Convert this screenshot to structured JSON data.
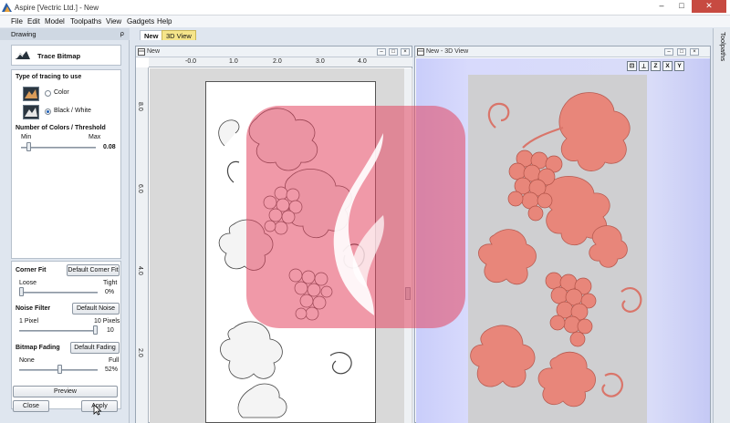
{
  "app": {
    "title": "Aspire [Vectric Ltd.] - New"
  },
  "window_controls": {
    "minimize": "‒",
    "maximize": "□",
    "close": "✕"
  },
  "menu": [
    "File",
    "Edit",
    "Model",
    "Toolpaths",
    "View",
    "Gadgets",
    "Help"
  ],
  "drawing_panel": {
    "header": "Drawing",
    "pin": "⍴",
    "tool_title": "Trace Bitmap",
    "type_section": "Type of tracing to use",
    "options": [
      {
        "label": "Color",
        "selected": false
      },
      {
        "label": "Black / White",
        "selected": true
      }
    ],
    "threshold": {
      "title": "Number of Colors / Threshold",
      "min_label": "Min",
      "max_label": "Max",
      "value": "0.08",
      "level": 0.08
    },
    "corner_fit": {
      "title": "Corner Fit",
      "button": "Default Corner Fit",
      "left_label": "Loose",
      "right_label": "Tight",
      "value": "0%",
      "level": 0.0
    },
    "noise_filter": {
      "title": "Noise Filter",
      "button": "Default Noise",
      "left_label": "1 Pixel",
      "right_label": "10 Pixels",
      "value": "10",
      "level": 1.0
    },
    "bitmap_fading": {
      "title": "Bitmap Fading",
      "button": "Default Fading",
      "left_label": "None",
      "right_label": "Full",
      "value": "52%",
      "level": 0.52
    },
    "preview_button": "Preview",
    "close_button": "Close",
    "apply_button": "Apply"
  },
  "tabs": [
    {
      "label": "New",
      "active": true
    },
    {
      "label": "3D View",
      "active": false
    }
  ],
  "toolpaths_strip": "Toolpaths",
  "view2d": {
    "title": "New",
    "ruler_top": [
      "-0.0",
      "1.0",
      "2.0",
      "3.0",
      "4.0"
    ],
    "ruler_left": [
      "8.0",
      "6.0",
      "4.0",
      "2.0"
    ]
  },
  "view3d": {
    "title": "New - 3D View",
    "view_buttons": [
      "⊡",
      "ISO",
      "Z",
      "X",
      "Y"
    ]
  },
  "colors": {
    "relief": "#e8867a",
    "watermark": "#e44660",
    "panel_bg": "#dfe6ef"
  }
}
